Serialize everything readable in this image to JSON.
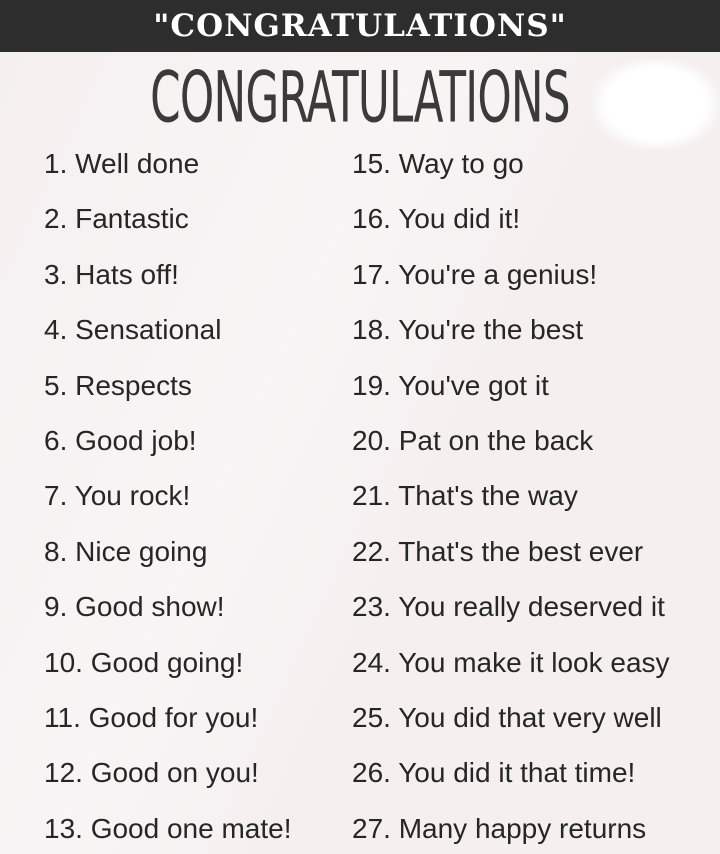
{
  "banner": {
    "title": "\"CONGRATULATIONS\""
  },
  "headline": {
    "text": "CONGRATULATIONS"
  },
  "left_column": [
    "1. Well done",
    "2. Fantastic",
    "3. Hats off!",
    "4. Sensational",
    "5. Respects",
    "6. Good job!",
    "7. You rock!",
    "8. Nice going",
    "9. Good show!",
    "10. Good going!",
    "11. Good for you!",
    "12. Good on you!",
    "13. Good one mate!"
  ],
  "right_column": [
    "15. Way to go",
    "16. You did it!",
    "17. You're a genius!",
    "18. You're the best",
    "19. You've got it",
    "20. Pat on the back",
    "21. That's the way",
    "22. That's the best ever",
    "23. You really deserved it",
    "24. You make it look easy",
    "25. You did that very well",
    "26. You did it that time!",
    "27. Many happy returns"
  ],
  "colors": {
    "banner_bg": "#2d2d2d",
    "banner_text": "#ffffff",
    "page_bg": "#f5eff0",
    "text": "#262626"
  }
}
